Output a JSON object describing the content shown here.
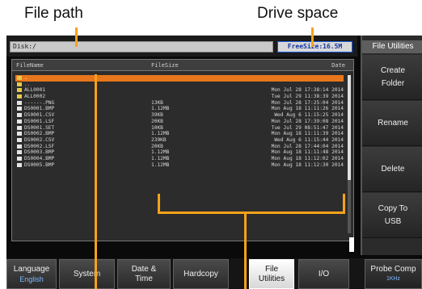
{
  "callouts": {
    "file_path": "File path",
    "drive_space": "Drive space"
  },
  "topbar": {
    "path": "Disk:/",
    "free_size": "FreeSize:16.5M"
  },
  "browser": {
    "columns": {
      "name": "FileName",
      "size": "FileSize",
      "date": "Date"
    },
    "rows": [
      {
        "type": "folder",
        "name": ".",
        "size": "",
        "date": "",
        "selected": true
      },
      {
        "type": "folder",
        "name": "..",
        "size": "",
        "date": ""
      },
      {
        "type": "folder",
        "name": "ALL0001",
        "size": "",
        "date": "Mon Jul 28 17:38:14 2014"
      },
      {
        "type": "folder",
        "name": "ALL0002",
        "size": "",
        "date": "Tue Jul 29 11:38:39 2014"
      },
      {
        "type": "file",
        "name": "------.PNG",
        "size": "13KB",
        "date": "Mon Jul 28 17:25:04 2014"
      },
      {
        "type": "file",
        "name": "DS0001.BMP",
        "size": "1.12MB",
        "date": "Mon Aug 18 11:11:26 2014"
      },
      {
        "type": "file",
        "name": "DS0001.CSV",
        "size": "39KB",
        "date": "Wed Aug  6 11:15:25 2014"
      },
      {
        "type": "file",
        "name": "DS0001.LSF",
        "size": "20KB",
        "date": "Mon Jul 28 17:39:08 2014"
      },
      {
        "type": "file",
        "name": "DS0001.SET",
        "size": "10KB",
        "date": "Tue Jul 29 08:51:47 2014"
      },
      {
        "type": "file",
        "name": "DS0002.BMP",
        "size": "1.12MB",
        "date": "Mon Aug 18 11:11:39 2014"
      },
      {
        "type": "file",
        "name": "DS0002.CSV",
        "size": "239KB",
        "date": "Wed Aug  6 11:15:44 2014"
      },
      {
        "type": "file",
        "name": "DS0002.LSF",
        "size": "20KB",
        "date": "Mon Jul 28 17:44:04 2014"
      },
      {
        "type": "file",
        "name": "DS0003.BMP",
        "size": "1.12MB",
        "date": "Mon Aug 18 11:11:48 2014"
      },
      {
        "type": "file",
        "name": "DS0004.BMP",
        "size": "1.12MB",
        "date": "Mon Aug 18 11:12:02 2014"
      },
      {
        "type": "file",
        "name": "DS0005.BMP",
        "size": "1.12MB",
        "date": "Mon Aug 18 11:12:30 2014"
      }
    ]
  },
  "side_menu": {
    "title": "File Utilities",
    "create_folder": [
      "Create",
      "Folder"
    ],
    "rename": "Rename",
    "delete": "Delete",
    "copy_to_usb": [
      "Copy To",
      "USB"
    ]
  },
  "bottom_menu": {
    "language": "Language",
    "language_value": "English",
    "system": "System",
    "date_time": [
      "Date &",
      "Time"
    ],
    "hardcopy": "Hardcopy",
    "file_utilities": [
      "File",
      "Utilities"
    ],
    "io": "I/O",
    "probe_comp": "Probe Comp",
    "probe_comp_value": "1KHz"
  },
  "colors": {
    "accent_orange": "#f7a21b",
    "selected_row": "#e8761c",
    "free_size_border": "#1e5bd9"
  }
}
